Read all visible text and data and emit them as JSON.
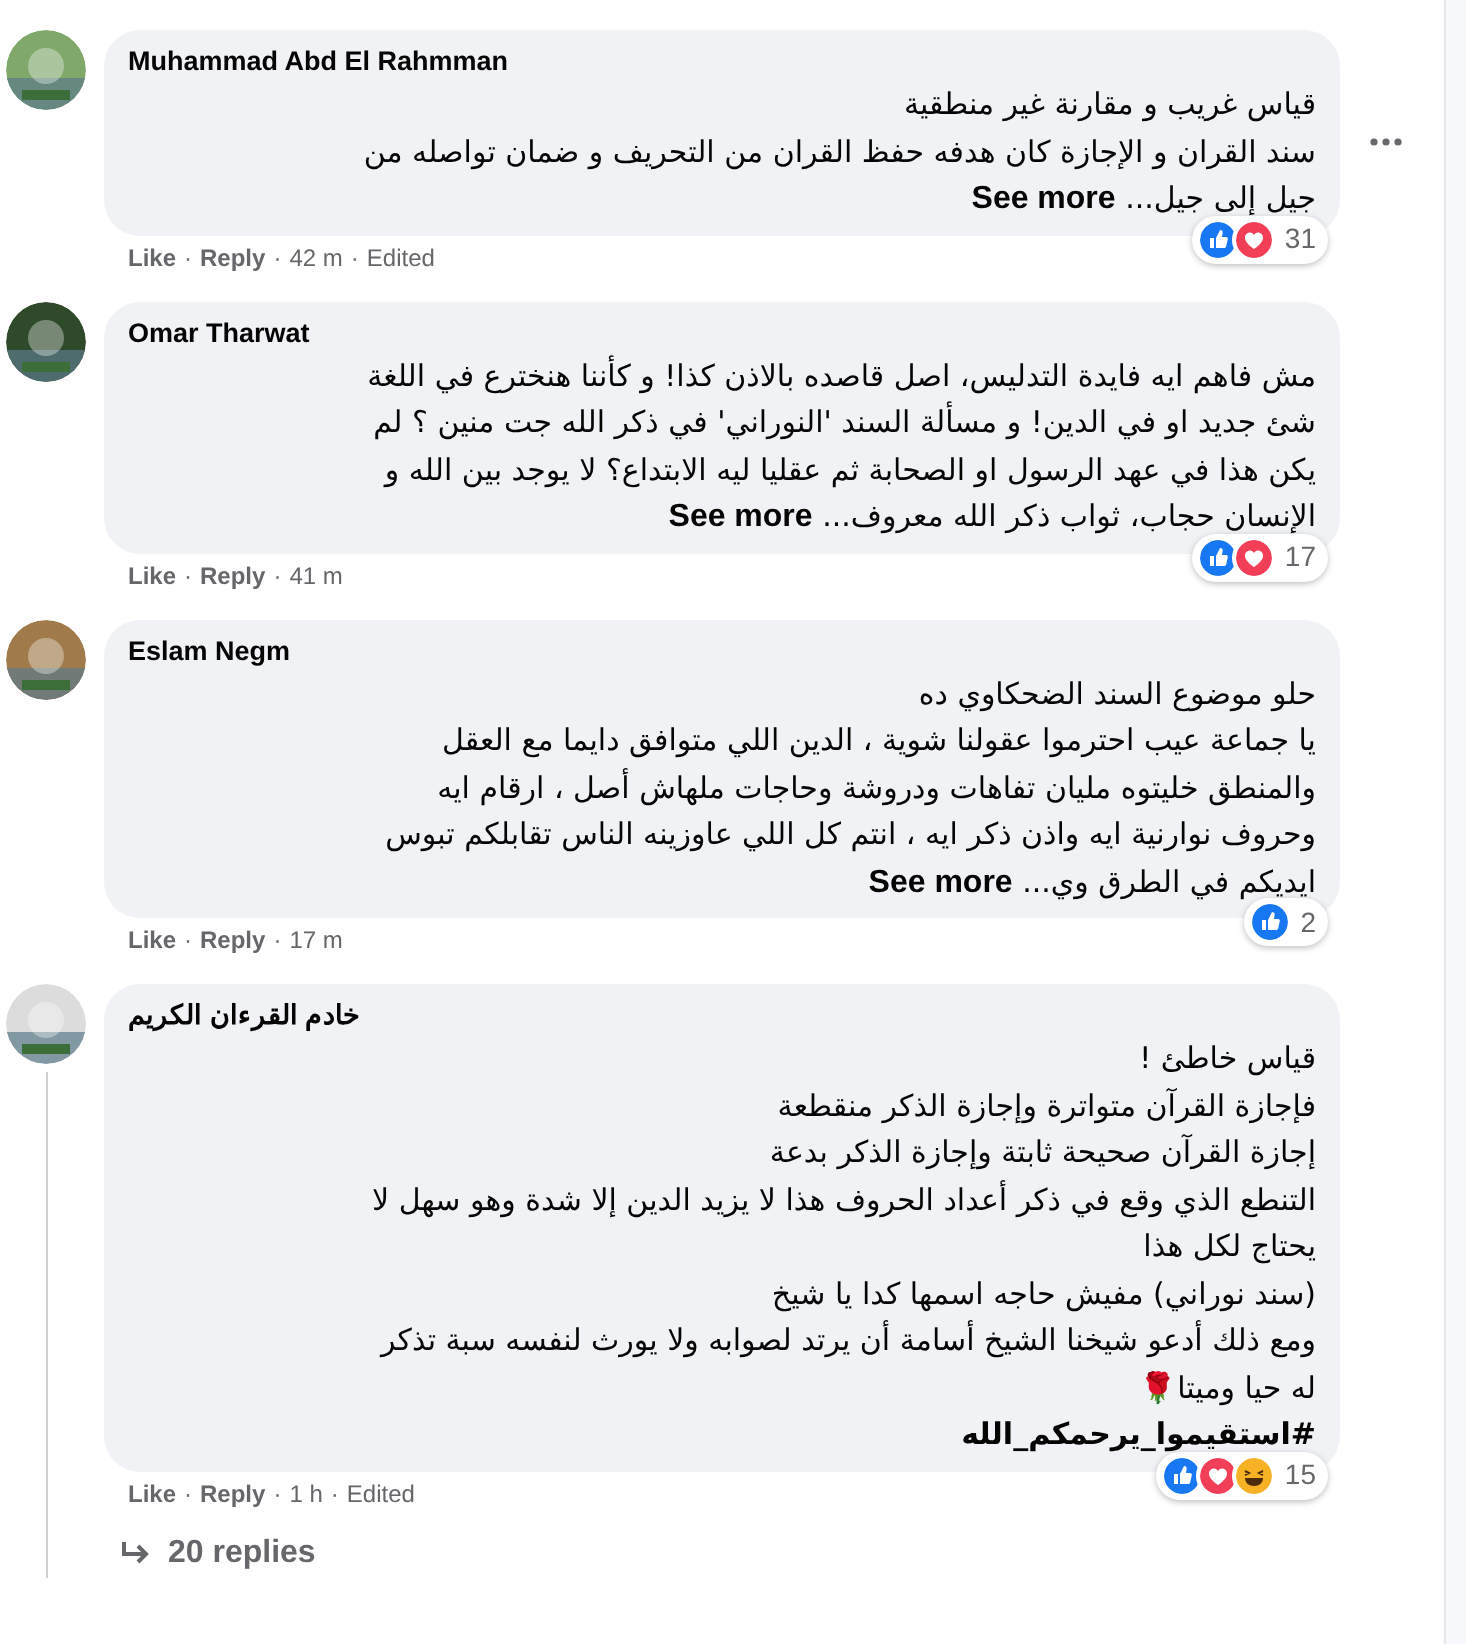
{
  "comments": [
    {
      "author": "Muhammad Abd El Rahmman",
      "lines": [
        "قياس غريب و مقارنة غير منطقية",
        "سند القران و الإجازة كان هدفه حفظ القران من التحريف و ضمان تواصله من",
        "جيل إلى جيل..."
      ],
      "see_more": "See more",
      "reactions": [
        {
          "kind": "like"
        },
        {
          "kind": "love"
        }
      ],
      "reaction_count": "31",
      "like": "Like",
      "separator": "·",
      "reply": "Reply",
      "time": "42 m",
      "edited": "Edited"
    },
    {
      "author": "Omar Tharwat",
      "lines": [
        "مش فاهم ايه فايدة التدليس، اصل قاصده بالاذن كذا! و كأننا هنخترع في اللغة",
        "شئ جديد او في الدين! و مسألة السند 'النوراني' في ذكر الله جت منين ؟ لم",
        "يكن هذا في عهد الرسول او الصحابة ثم عقليا ليه الابتداع؟ لا يوجد بين الله و",
        "الإنسان حجاب، ثواب ذكر الله معروف..."
      ],
      "see_more": "See more",
      "reactions": [
        {
          "kind": "like"
        },
        {
          "kind": "love"
        }
      ],
      "reaction_count": "17",
      "like": "Like",
      "separator": "·",
      "reply": "Reply",
      "time": "41 m"
    },
    {
      "author": "Eslam Negm",
      "lines": [
        "حلو موضوع السند الضحكاوي ده",
        "يا جماعة عيب احترموا عقولنا شوية ، الدين اللي متوافق دايما مع العقل",
        "والمنطق خليتوه مليان تفاهات ودروشة وحاجات ملهاش أصل ، ارقام ايه",
        "وحروف نوارنية ايه واذن ذكر ايه ، انتم كل اللي عاوزينه الناس تقابلكم تبوس",
        "ايديكم في الطرق وي..."
      ],
      "see_more": "See more",
      "reactions": [
        {
          "kind": "like"
        }
      ],
      "reaction_count": "2",
      "like": "Like",
      "separator": "·",
      "reply": "Reply",
      "time": "17 m"
    },
    {
      "author": "خادم القرءان الكريم",
      "lines": [
        "قياس خاطئ !",
        "فإجازة القرآن متواترة وإجازة الذكر منقطعة",
        "إجازة القرآن صحيحة ثابتة وإجازة الذكر بدعة",
        "التنطع الذي وقع في ذكر أعداد الحروف هذا لا يزيد الدين إلا شدة وهو سهل لا",
        "يحتاج لكل هذا",
        "(سند نوراني) مفيش حاجه اسمها كدا يا شيخ",
        "ومع ذلك أدعو شيخنا الشيخ أسامة أن يرتد لصوابه ولا يورث لنفسه سبة تذكر",
        "له حيا وميتا🌹"
      ],
      "hashtag": "#استقيموا_يرحمكم_الله",
      "reactions": [
        {
          "kind": "like"
        },
        {
          "kind": "love"
        },
        {
          "kind": "haha"
        }
      ],
      "reaction_count": "15",
      "like": "Like",
      "separator": "·",
      "reply": "Reply",
      "time": "1 h",
      "edited": "Edited",
      "replies": "20 replies"
    }
  ]
}
